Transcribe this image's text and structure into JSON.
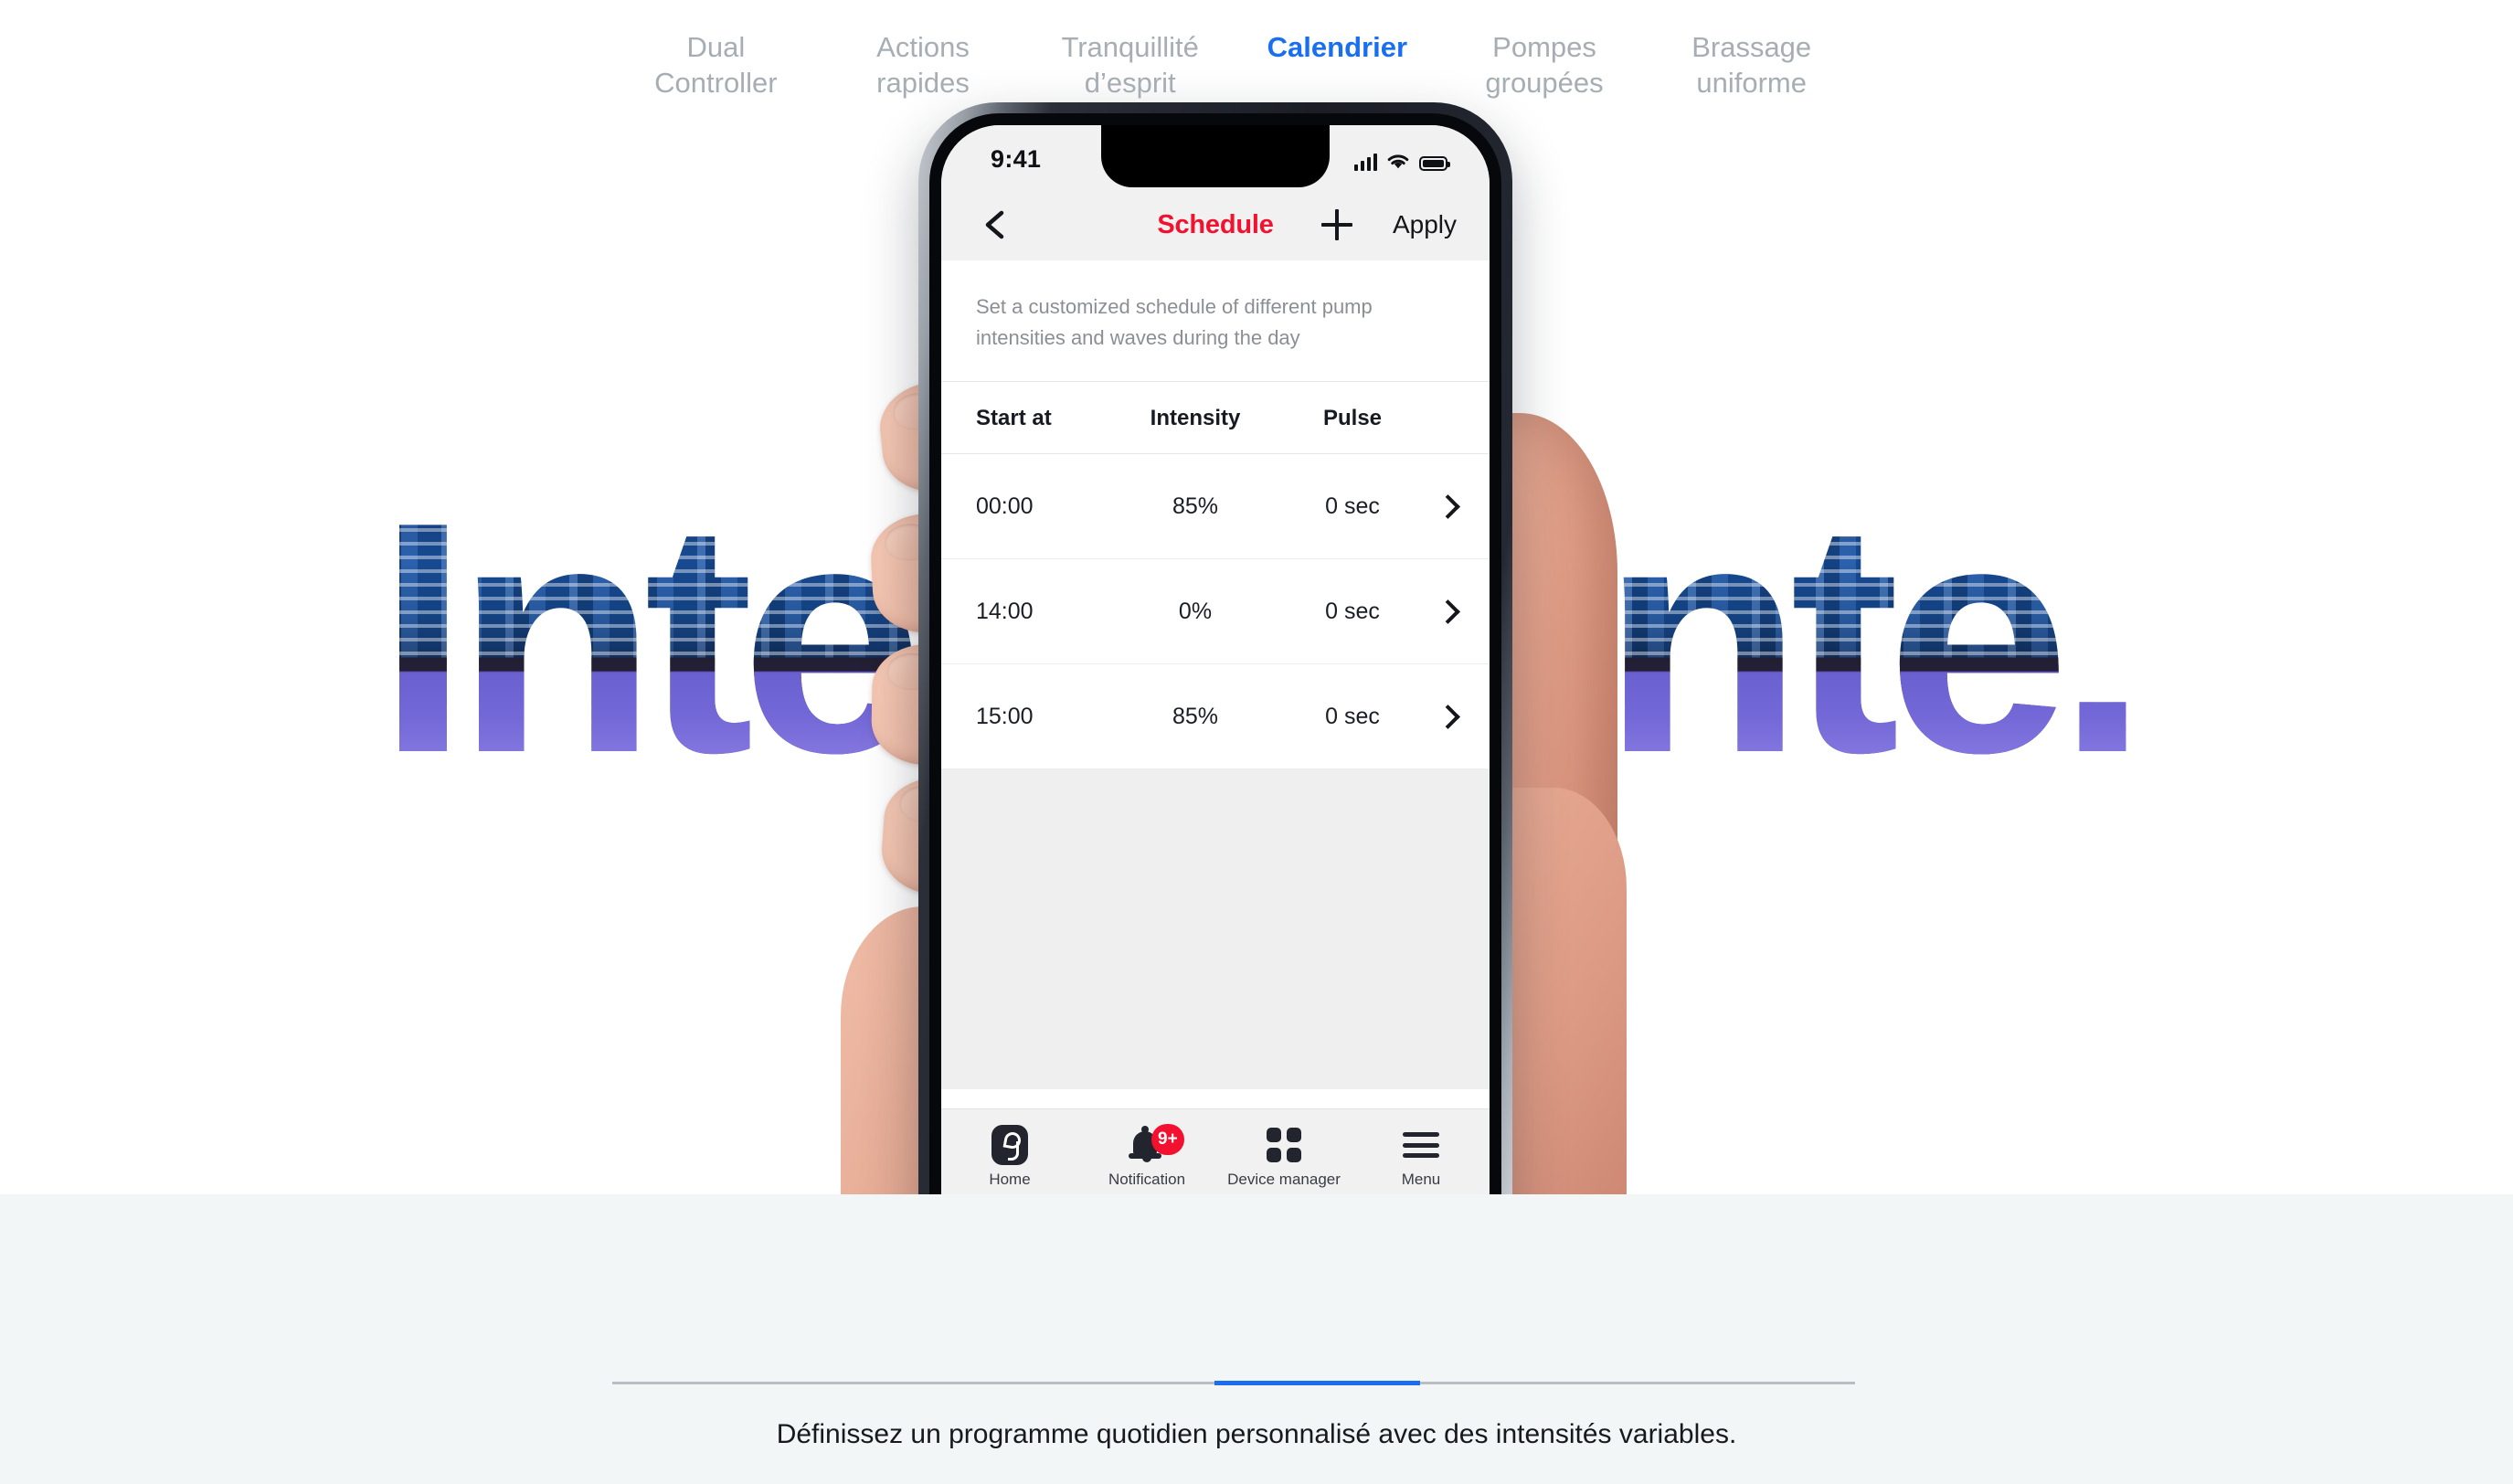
{
  "hero": {
    "background_word_left": "Inte",
    "background_word_right": "ente.",
    "background_word_full": "Intelligente.",
    "word_color_solid": "#222843"
  },
  "phone": {
    "status_bar": {
      "time": "9:41",
      "cellular_icon": "signal-bars-icon",
      "wifi_icon": "wifi-icon",
      "battery_icon": "battery-full-icon"
    },
    "nav": {
      "back_icon": "chevron-left-icon",
      "title": "Schedule",
      "title_color": "#f2112f",
      "add_icon": "plus-icon",
      "apply_label": "Apply"
    },
    "description": "Set a customized schedule of different pump intensities and waves during the day",
    "table": {
      "columns": [
        "Start at",
        "Intensity",
        "Pulse"
      ],
      "rows": [
        {
          "start_at": "00:00",
          "intensity": "85%",
          "pulse": "0 sec",
          "chevron": "chevron-right-icon"
        },
        {
          "start_at": "14:00",
          "intensity": "0%",
          "pulse": "0 sec",
          "chevron": "chevron-right-icon"
        },
        {
          "start_at": "15:00",
          "intensity": "85%",
          "pulse": "0 sec",
          "chevron": "chevron-right-icon"
        }
      ]
    },
    "tabbar": [
      {
        "icon": "seahorse-home-icon",
        "label": "Home",
        "badge": ""
      },
      {
        "icon": "bell-icon",
        "label": "Notification",
        "badge": "9+"
      },
      {
        "icon": "grid-icon",
        "label": "Device manager",
        "badge": ""
      },
      {
        "icon": "hamburger-menu-icon",
        "label": "Menu",
        "badge": ""
      }
    ],
    "badge_color": "#f2112f"
  },
  "lower": {
    "tabs": [
      {
        "label": "Dual\nController",
        "line1": "Dual",
        "line2": "Controller",
        "active": false
      },
      {
        "label": "Actions rapides",
        "line1": "Actions",
        "line2": "rapides",
        "active": false
      },
      {
        "label": "Tranquillité d’esprit",
        "line1": "Tranquillité",
        "line2": "d’esprit",
        "active": false
      },
      {
        "label": "Calendrier",
        "line1": "Calendrier",
        "line2": "",
        "active": true
      },
      {
        "label": "Pompes groupées",
        "line1": "Pompes",
        "line2": "groupées",
        "active": false
      },
      {
        "label": "Brassage uniforme",
        "line1": "Brassage",
        "line2": "uniforme",
        "active": false
      }
    ],
    "active_color": "#1a6ff0",
    "inactive_color": "#a6aeb4",
    "caption": "Définissez un programme quotidien personnalisé avec des intensités variables."
  }
}
